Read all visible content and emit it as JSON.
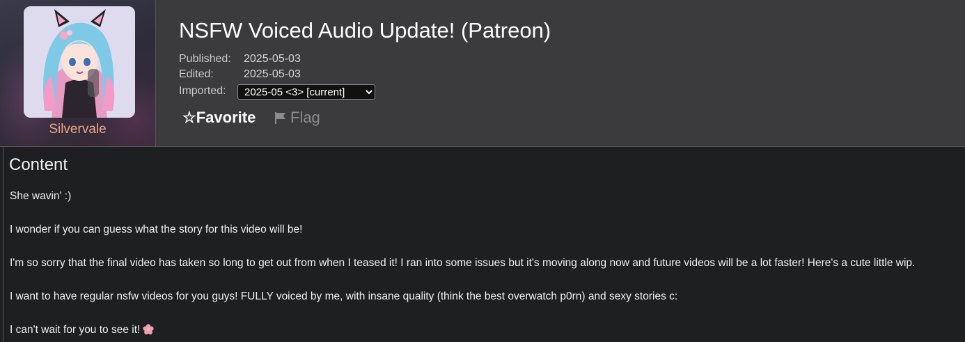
{
  "post": {
    "title": "NSFW Voiced Audio Update! (Patreon)",
    "artist": "Silvervale",
    "published_label": "Published:",
    "published": "2025-05-03",
    "edited_label": "Edited:",
    "edited": "2025-05-03",
    "imported_label": "Imported:",
    "imported_selected": "2025-05 <3> [current]"
  },
  "actions": {
    "favorite_label": "☆Favorite",
    "flag_label": "Flag",
    "flag_icon": "flag-icon"
  },
  "content": {
    "heading": "Content",
    "paragraphs": [
      "She wavin' :)",
      "I wonder if you can guess what the story for this video will be!",
      "I'm so sorry that the final video has taken so long to get out from when I teased it! I ran into some issues but it's moving along now and future videos will be a lot faster! Here's a cute little wip.",
      "I want to have regular nsfw videos for you guys! FULLY voiced by me, with insane quality (think the best overwatch p0rn) and sexy stories c:",
      "I can't wait for you to see it!"
    ],
    "emoji_icon": "cherry-blossom-icon"
  },
  "colors": {
    "header_bg": "#3b3b3e",
    "page_bg": "#1e1f21",
    "artist_name": "#f0a488",
    "flag_muted": "#8b8b8b"
  }
}
